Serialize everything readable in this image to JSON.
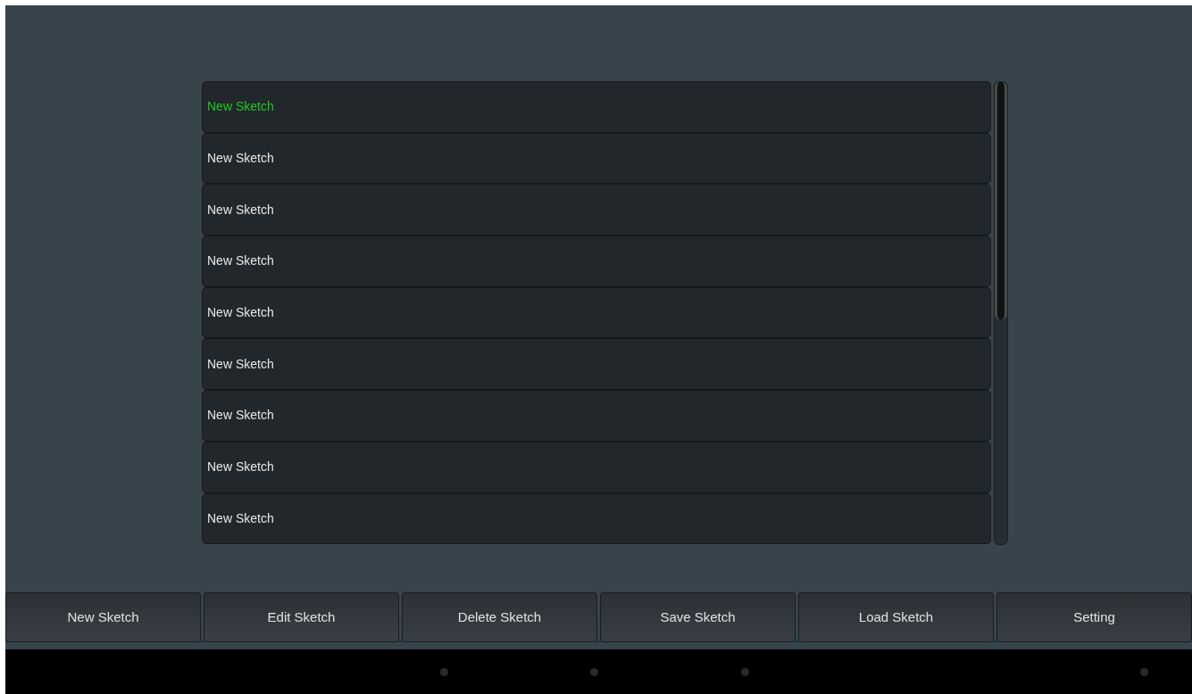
{
  "sketches": [
    {
      "name": "New Sketch",
      "selected": true
    },
    {
      "name": "New Sketch",
      "selected": false
    },
    {
      "name": "New Sketch",
      "selected": false
    },
    {
      "name": "New Sketch",
      "selected": false
    },
    {
      "name": "New Sketch",
      "selected": false
    },
    {
      "name": "New Sketch",
      "selected": false
    },
    {
      "name": "New Sketch",
      "selected": false
    },
    {
      "name": "New Sketch",
      "selected": false
    },
    {
      "name": "New Sketch",
      "selected": false
    }
  ],
  "toolbar": [
    "New Sketch",
    "Edit Sketch",
    "Delete Sketch",
    "Save Sketch",
    "Load Sketch",
    "Setting"
  ]
}
